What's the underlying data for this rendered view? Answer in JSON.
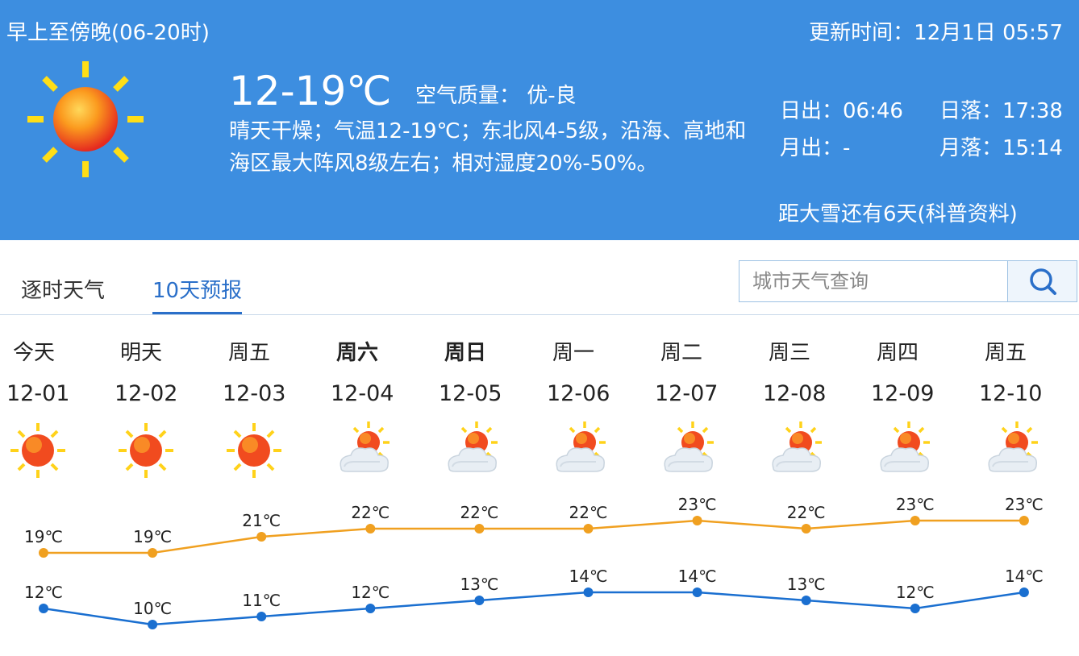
{
  "header": {
    "period": "早上至傍晚(06-20时)",
    "update_time": "更新时间：12月1日 05:57",
    "temp_range": "12-19℃",
    "air_quality": "空气质量： 优-良",
    "description": "晴天干燥；气温12-19℃；东北风4-5级，沿海、高地和海区最大阵风8级左右；相对湿度20%-50%。",
    "sunrise": "日出：06:46",
    "sunset": "日落：17:38",
    "moonrise": "月出：-",
    "moonset": "月落：15:14",
    "snow_countdown": "距大雪还有6天(科普资料)",
    "icon": "sun-icon"
  },
  "tabs": [
    {
      "label": "逐时天气",
      "active": false
    },
    {
      "label": "10天预报",
      "active": true
    }
  ],
  "search": {
    "placeholder": "城市天气查询",
    "icon": "search-icon"
  },
  "colors": {
    "header_bg": "#3d8ee0",
    "high_line": "#f0a020",
    "low_line": "#1a6fd0",
    "active_tab": "#2a6fc9"
  },
  "forecast": [
    {
      "weekday": "今天",
      "date": "12-01",
      "bold": false,
      "icon": "sunny-icon",
      "high": "19℃",
      "low": "12℃"
    },
    {
      "weekday": "明天",
      "date": "12-02",
      "bold": false,
      "icon": "sunny-icon",
      "high": "19℃",
      "low": "10℃"
    },
    {
      "weekday": "周五",
      "date": "12-03",
      "bold": false,
      "icon": "sunny-icon",
      "high": "21℃",
      "low": "11℃"
    },
    {
      "weekday": "周六",
      "date": "12-04",
      "bold": true,
      "icon": "partly-cloudy-icon",
      "high": "22℃",
      "low": "12℃"
    },
    {
      "weekday": "周日",
      "date": "12-05",
      "bold": true,
      "icon": "partly-cloudy-icon",
      "high": "22℃",
      "low": "13℃"
    },
    {
      "weekday": "周一",
      "date": "12-06",
      "bold": false,
      "icon": "partly-cloudy-icon",
      "high": "22℃",
      "low": "14℃"
    },
    {
      "weekday": "周二",
      "date": "12-07",
      "bold": false,
      "icon": "partly-cloudy-icon",
      "high": "23℃",
      "low": "14℃"
    },
    {
      "weekday": "周三",
      "date": "12-08",
      "bold": false,
      "icon": "partly-cloudy-icon",
      "high": "22℃",
      "low": "13℃"
    },
    {
      "weekday": "周四",
      "date": "12-09",
      "bold": false,
      "icon": "partly-cloudy-icon",
      "high": "23℃",
      "low": "12℃"
    },
    {
      "weekday": "周五",
      "date": "12-10",
      "bold": false,
      "icon": "partly-cloudy-icon",
      "high": "23℃",
      "low": "14℃"
    }
  ],
  "chart_data": {
    "type": "line",
    "categories": [
      "12-01",
      "12-02",
      "12-03",
      "12-04",
      "12-05",
      "12-06",
      "12-07",
      "12-08",
      "12-09",
      "12-10"
    ],
    "series": [
      {
        "values": [
          19,
          19,
          21,
          22,
          22,
          22,
          23,
          22,
          23,
          23
        ]
      },
      {
        "values": [
          12,
          10,
          11,
          12,
          13,
          14,
          14,
          13,
          12,
          14
        ]
      }
    ]
  }
}
